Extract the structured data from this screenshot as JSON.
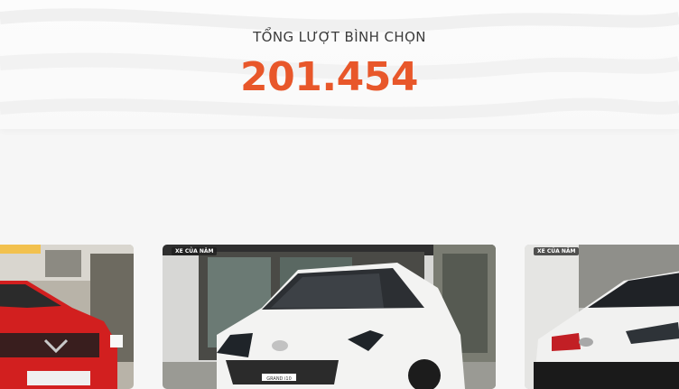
{
  "votes": {
    "label": "TỔNG LƯỢT BÌNH CHỌN",
    "total": "201.454"
  },
  "cards": [
    {
      "icon": "red-car-image",
      "badge": ""
    },
    {
      "icon": "white-hatchback-image",
      "badge": "XE CỦA NĂM",
      "plate": "GRAND i10"
    },
    {
      "icon": "white-car-image",
      "badge": "XE CỦA NĂM"
    }
  ],
  "colors": {
    "accent": "#e8572a",
    "text": "#3b3b3b",
    "background": "#f6f6f6"
  }
}
